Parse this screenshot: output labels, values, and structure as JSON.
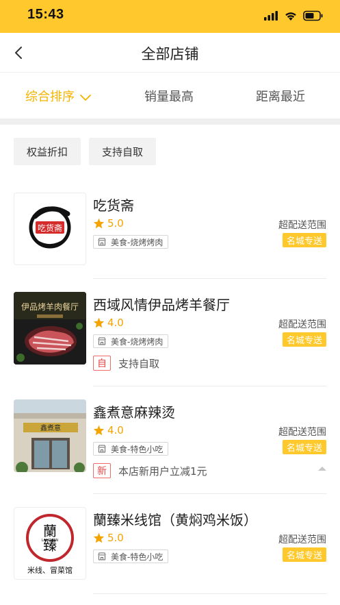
{
  "status_bar": {
    "time": "15:43"
  },
  "nav": {
    "title": "全部店铺",
    "back_icon": "chevron-left-icon"
  },
  "sort_tabs": [
    {
      "label": "综合排序",
      "active": true
    },
    {
      "label": "销量最高",
      "active": false
    },
    {
      "label": "距离最近",
      "active": false
    }
  ],
  "filters": [
    "权益折扣",
    "支持自取"
  ],
  "stores": [
    {
      "name": "吃货斋",
      "rating": "5.0",
      "category": "美食-烧烤烤肉",
      "range_text": "超配送范围",
      "delivery_badge": "名城专送",
      "logo_text": "吃货斋"
    },
    {
      "name": "西域风情伊品烤羊餐厅",
      "rating": "4.0",
      "category": "美食-烧烤烤肉",
      "range_text": "超配送范围",
      "delivery_badge": "名城专送",
      "promo_badge": "自",
      "promo_text": "支持自取",
      "logo_text": "伊品烤羊肉餐厅"
    },
    {
      "name": "鑫煮意麻辣烫",
      "rating": "4.0",
      "category": "美食-特色小吃",
      "range_text": "超配送范围",
      "delivery_badge": "名城专送",
      "promo_badge": "新",
      "promo_text": "本店新用户立减1元",
      "logo_text": "鑫煮意"
    },
    {
      "name": "蘭臻米线馆（黄焖鸡米饭）",
      "rating": "5.0",
      "category": "美食-特色小吃",
      "range_text": "超配送范围",
      "delivery_badge": "名城专送",
      "logo_text": "蘭臻",
      "logo_subtext": "LANZHEN",
      "logo_caption": "米线、冒菜馆"
    }
  ],
  "colors": {
    "accent": "#FFC82C",
    "accent_text": "#F5B300",
    "promo_red": "#E84848"
  }
}
